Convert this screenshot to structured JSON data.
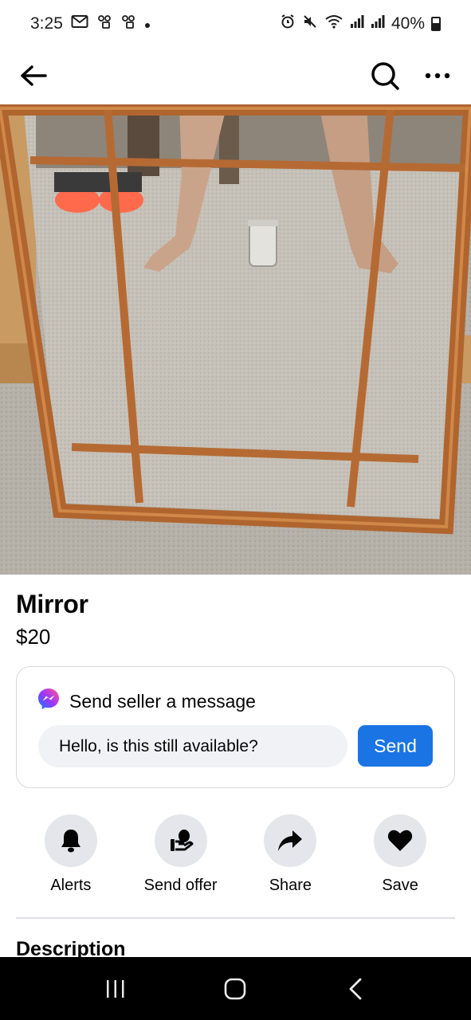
{
  "status_bar": {
    "time": "3:25",
    "battery": "40%",
    "left_icons": [
      "gmail-icon",
      "voicemail-icon",
      "voicemail-icon",
      "dot-icon"
    ],
    "right_icons": [
      "alarm-icon",
      "mute-icon",
      "wifi-icon",
      "signal-icon",
      "signal-icon",
      "battery-icon"
    ]
  },
  "nav": {
    "back_icon": "arrow-left-icon",
    "search_icon": "search-icon",
    "more_icon": "more-icon"
  },
  "listing": {
    "title": "Mirror",
    "price": "$20"
  },
  "message": {
    "heading": "Send seller a message",
    "input_value": "Hello, is this still available?",
    "send_label": "Send"
  },
  "actions": [
    {
      "label": "Alerts",
      "icon": "bell-icon"
    },
    {
      "label": "Send offer",
      "icon": "offer-icon"
    },
    {
      "label": "Share",
      "icon": "share-icon"
    },
    {
      "label": "Save",
      "icon": "heart-icon"
    }
  ],
  "description": {
    "heading": "Description"
  },
  "colors": {
    "accent": "#1b74e4",
    "chip_bg": "#e4e6eb",
    "input_bg": "#f0f2f5"
  }
}
